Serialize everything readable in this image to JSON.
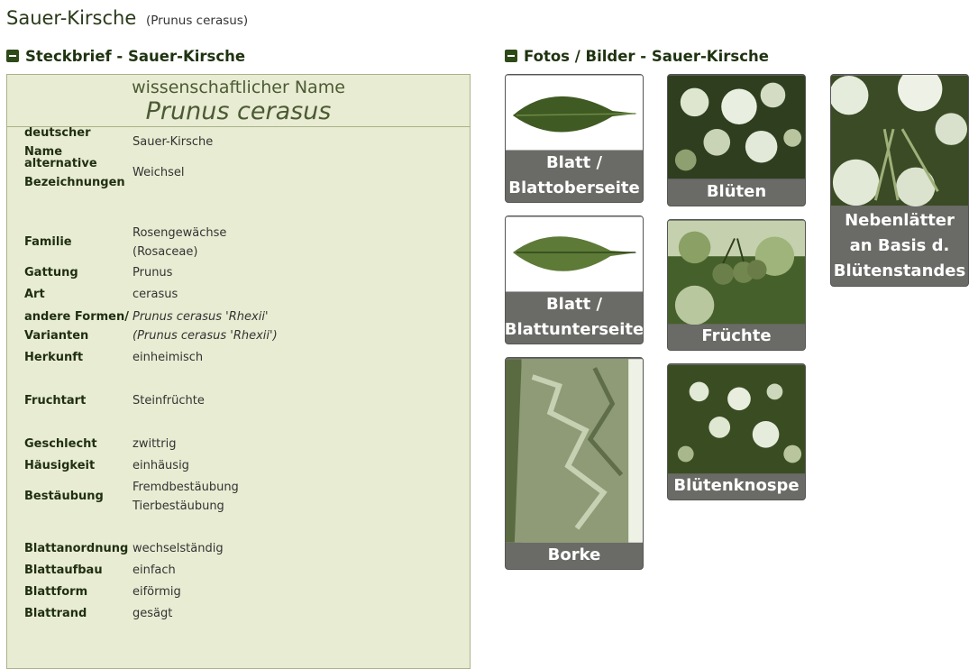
{
  "page": {
    "title": "Sauer-Kirsche",
    "title_sci": "(Prunus cerasus)"
  },
  "profile": {
    "heading": "Steckbrief - Sauer-Kirsche",
    "sci_label": "wissenschaftlicher Name",
    "sci_name": "Prunus cerasus",
    "rows": [
      {
        "key": "deutscher Name",
        "value": "Sauer-Kirsche"
      },
      {
        "key": "alternative Bezeichnungen",
        "value": "Weichsel"
      },
      {
        "key": "Familie",
        "value": "Rosengewächse (Rosaceae)"
      },
      {
        "key": "Gattung",
        "value": "Prunus"
      },
      {
        "key": "Art",
        "value": "cerasus"
      },
      {
        "key": "andere Formen/ Varianten",
        "value": "Prunus cerasus 'Rhexii'",
        "value2": "(Prunus cerasus 'Rhexii')"
      },
      {
        "key": "Herkunft",
        "value": "einheimisch"
      },
      {
        "key": "Fruchtart",
        "value": "Steinfrüchte"
      },
      {
        "key": "Geschlecht",
        "value": "zwittrig"
      },
      {
        "key": "Häusigkeit",
        "value": "einhäusig"
      },
      {
        "key": "Bestäubung",
        "value": "Fremdbestäubung",
        "value2": "Tierbestäubung"
      },
      {
        "key": "Blattanordnung",
        "value": "wechselständig"
      },
      {
        "key": "Blattaufbau",
        "value": "einfach"
      },
      {
        "key": "Blattform",
        "value": "eiförmig"
      },
      {
        "key": "Blattrand",
        "value": "gesägt"
      }
    ]
  },
  "gallery": {
    "heading": "Fotos / Bilder - Sauer-Kirsche",
    "items": [
      {
        "caption": "Blatt / Blattoberseite",
        "icon": "leaf-top-image"
      },
      {
        "caption": "Blüten",
        "icon": "blossom-image"
      },
      {
        "caption": "Nebenlätter an Basis d. Blütenstandes",
        "icon": "stipules-image"
      },
      {
        "caption": "Blatt / Blattunterseite",
        "icon": "leaf-bottom-image"
      },
      {
        "caption": "Früchte",
        "icon": "cherries-image"
      },
      {
        "caption": "Borke",
        "icon": "bark-image"
      },
      {
        "caption": "Blütenknospe",
        "icon": "bud-image"
      }
    ]
  }
}
